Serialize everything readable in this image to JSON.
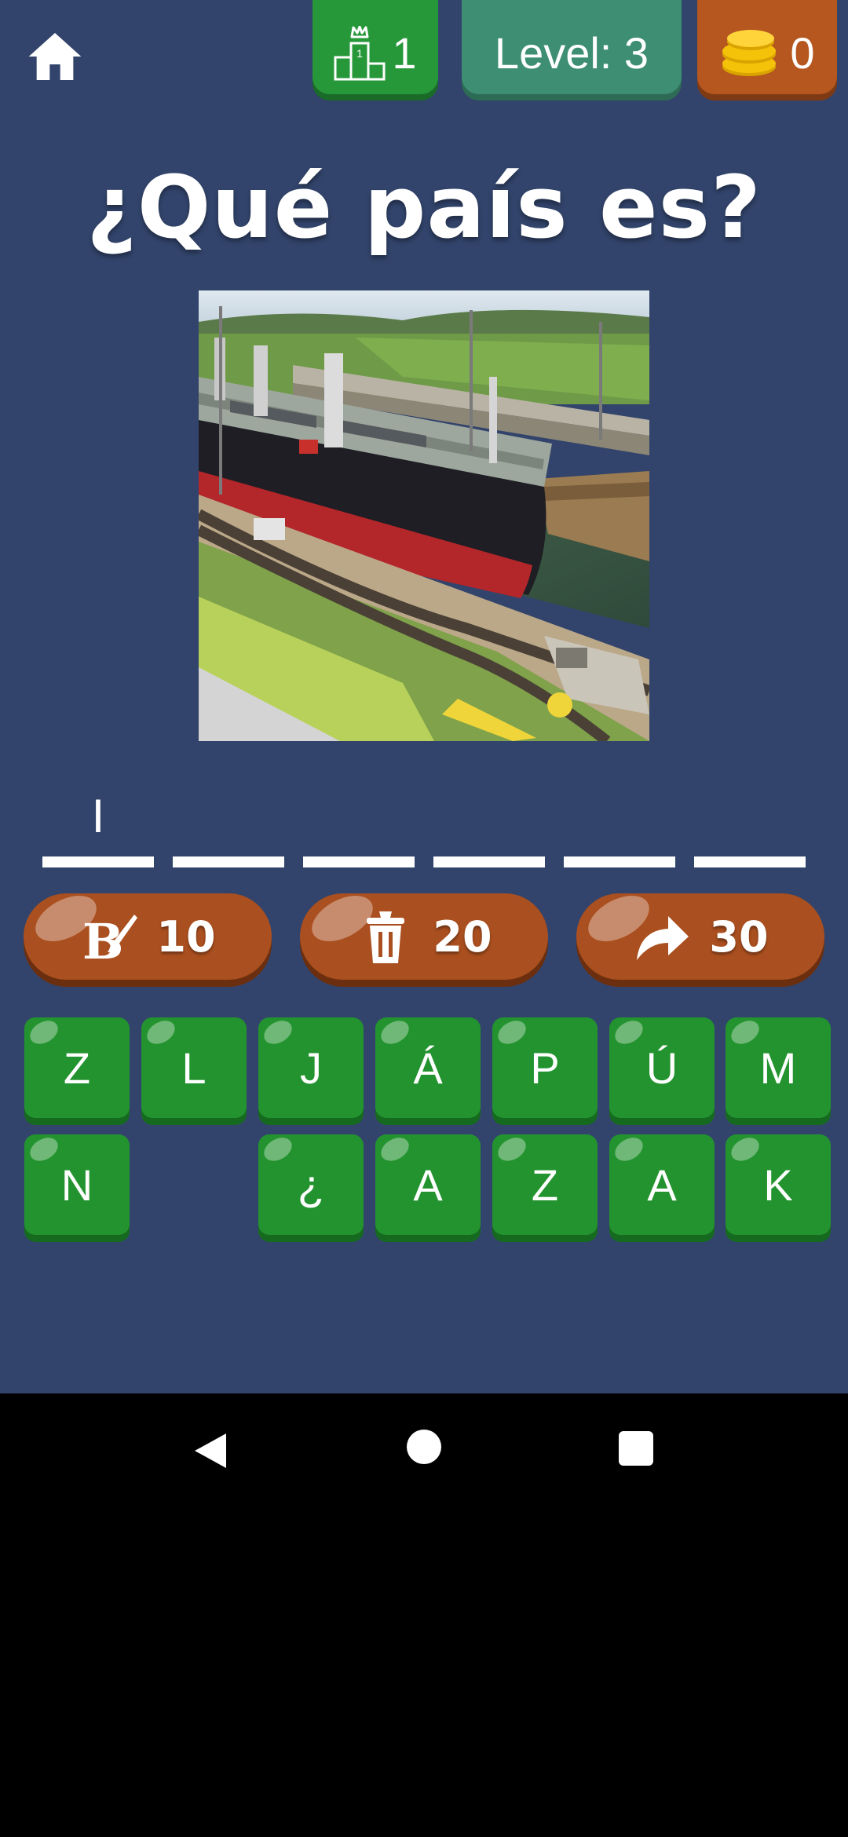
{
  "header": {
    "rank_value": "1",
    "level_label": "Level: 3",
    "coins_value": "0"
  },
  "title": "¿Qué país es?",
  "answer": {
    "slots": [
      "I",
      "",
      "",
      "",
      "",
      ""
    ]
  },
  "hints": [
    {
      "icon": "paint-brush-icon",
      "cost": "10"
    },
    {
      "icon": "trash-can-icon",
      "cost": "20"
    },
    {
      "icon": "skip-arrow-icon",
      "cost": "30"
    }
  ],
  "letters": {
    "row1": [
      "Z",
      "L",
      "J",
      "Á",
      "P",
      "Ú",
      "M"
    ],
    "row2": [
      "N",
      "",
      "¿",
      "A",
      "Z",
      "A",
      "K"
    ]
  },
  "colors": {
    "background": "#32446b",
    "tile_green": "#23932f",
    "hint_orange": "#aa4f1f",
    "level_teal": "#3d8e72",
    "coin_orange": "#b5571f"
  }
}
